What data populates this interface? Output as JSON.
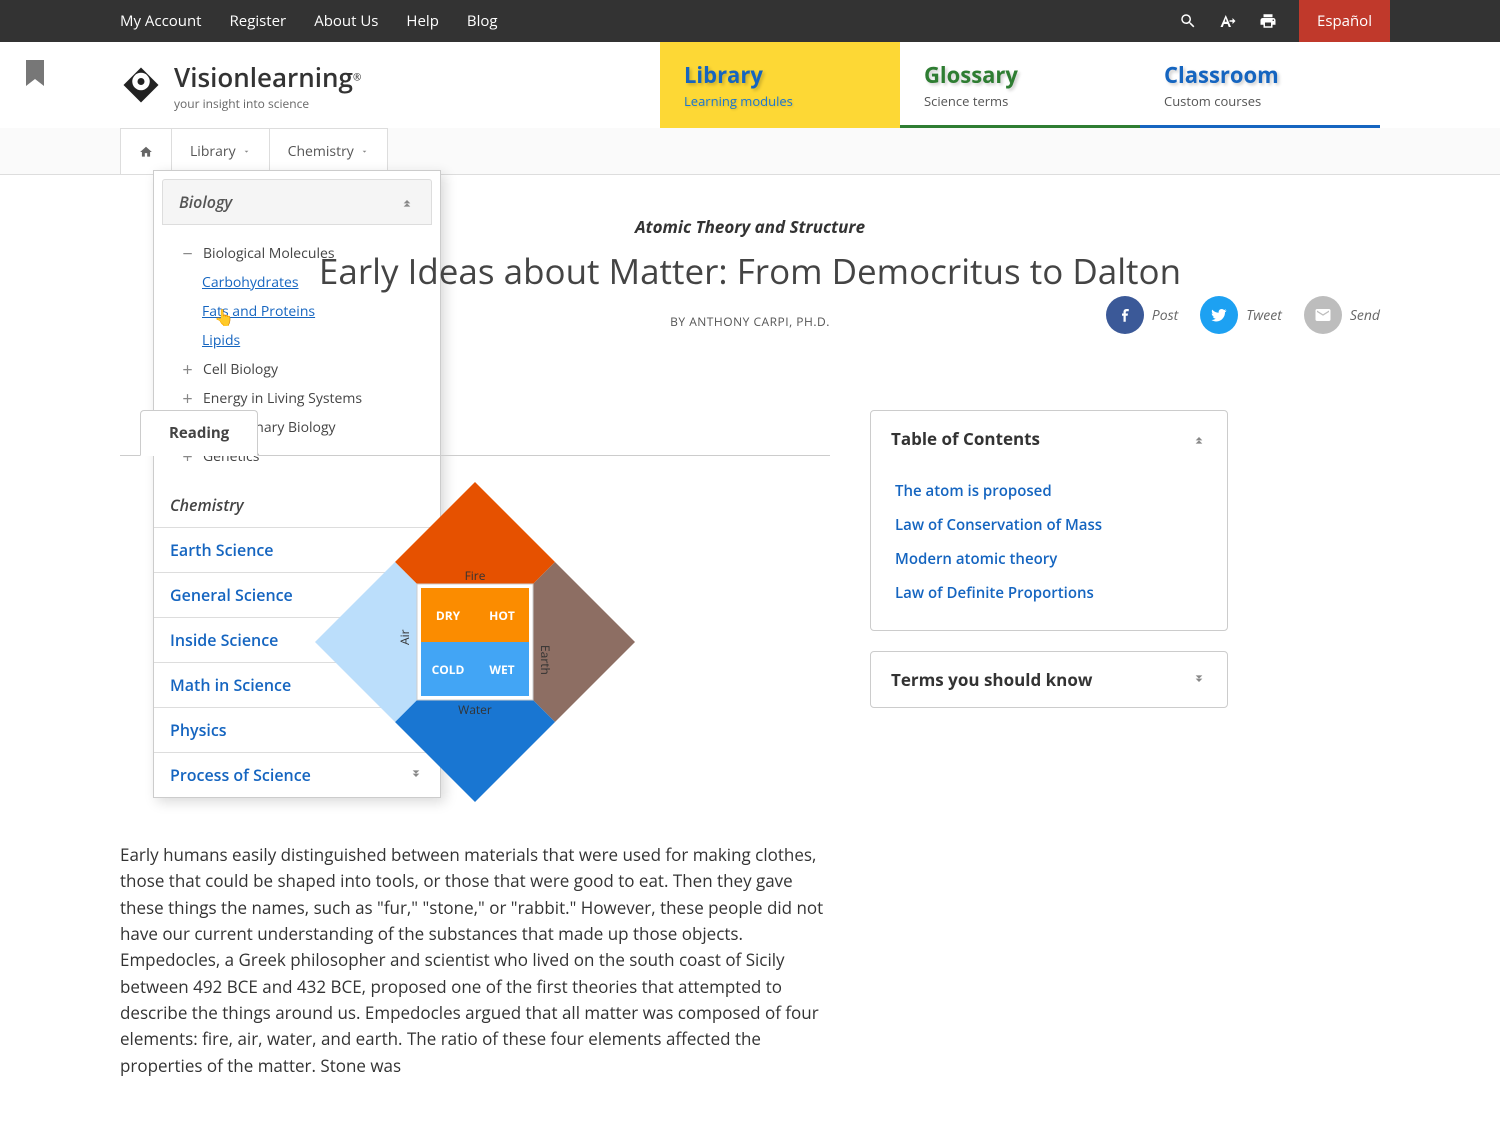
{
  "topbar": {
    "links": [
      "My Account",
      "Register",
      "About Us",
      "Help",
      "Blog"
    ],
    "lang": "Español"
  },
  "logo": {
    "main": "Visionlearning",
    "sub": "your insight into science"
  },
  "nav_tabs": [
    {
      "title": "Library",
      "sub": "Learning modules"
    },
    {
      "title": "Glossary",
      "sub": "Science terms"
    },
    {
      "title": "Classroom",
      "sub": "Custom courses"
    }
  ],
  "breadcrumb": {
    "library": "Library",
    "chemistry": "Chemistry"
  },
  "dropdown": {
    "biology": {
      "label": "Biology",
      "expanded_group": "Biological Molecules",
      "sub_items": [
        "Carbohydrates",
        "Fats and Proteins",
        "Lipids"
      ],
      "collapsed_groups": [
        "Cell Biology",
        "Energy in Living Systems",
        "Evolutionary Biology",
        "Genetics"
      ]
    },
    "chemistry_label": "Chemistry",
    "other_subjects": [
      "Earth Science",
      "General Science",
      "Inside Science",
      "Math in Science",
      "Physics",
      "Process of Science"
    ]
  },
  "article": {
    "topic": "Atomic Theory and Structure",
    "title": "Early Ideas about Matter: From Democritus to Dalton",
    "byline": "BY ANTHONY CARPI, PH.D.",
    "reading_tab": "Reading",
    "body_p1": "Early humans easily distinguished between materials that were used for making clothes, those that could be shaped into tools, or those that were good to eat. Then they gave these things the names, such as \"fur,\" \"stone,\" or \"rabbit.\" However, these people did not have our current understanding of the substances that made up those objects. Empedocles, a Greek philosopher and scientist who lived on the south coast of Sicily between 492 BCE and 432 BCE, proposed one of the first theories that attempted to describe the things around us. Empedocles argued that all matter was composed of four elements: fire, air, water, and earth. The ratio of these four elements affected the properties of the matter. Stone was"
  },
  "diagram": {
    "elements": [
      "Fire",
      "Earth",
      "Water",
      "Air"
    ],
    "qualities": [
      "DRY",
      "HOT",
      "COLD",
      "WET"
    ]
  },
  "social": {
    "post": "Post",
    "tweet": "Tweet",
    "send": "Send"
  },
  "sidebar": {
    "toc_title": "Table of Contents",
    "toc_items": [
      "The atom is proposed",
      "Law of Conservation of Mass",
      "Modern atomic theory",
      "Law of Definite Proportions"
    ],
    "terms_title": "Terms you should know"
  }
}
